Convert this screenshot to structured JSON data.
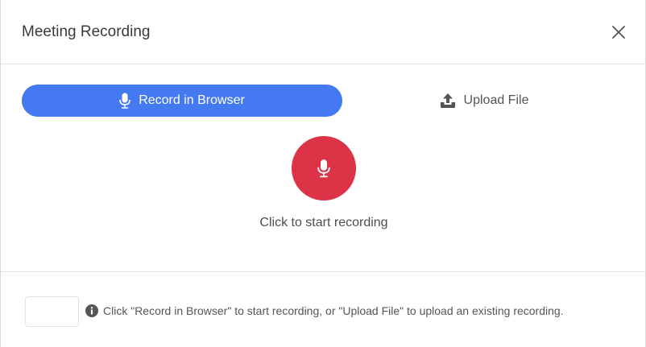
{
  "modal": {
    "title": "Meeting Recording",
    "close_icon": "close-icon"
  },
  "tabs": {
    "record": {
      "label": "Record in Browser",
      "icon": "microphone-icon",
      "active": true,
      "color": "#4479f2"
    },
    "upload": {
      "label": "Upload File",
      "icon": "upload-icon",
      "active": false
    }
  },
  "recorder": {
    "button_icon": "microphone-icon",
    "button_color": "#dd3346",
    "hint": "Click to start recording"
  },
  "footer": {
    "info_icon": "info-icon",
    "message": "Click \"Record in Browser\" to start recording, or \"Upload File\" to upload an existing recording."
  }
}
